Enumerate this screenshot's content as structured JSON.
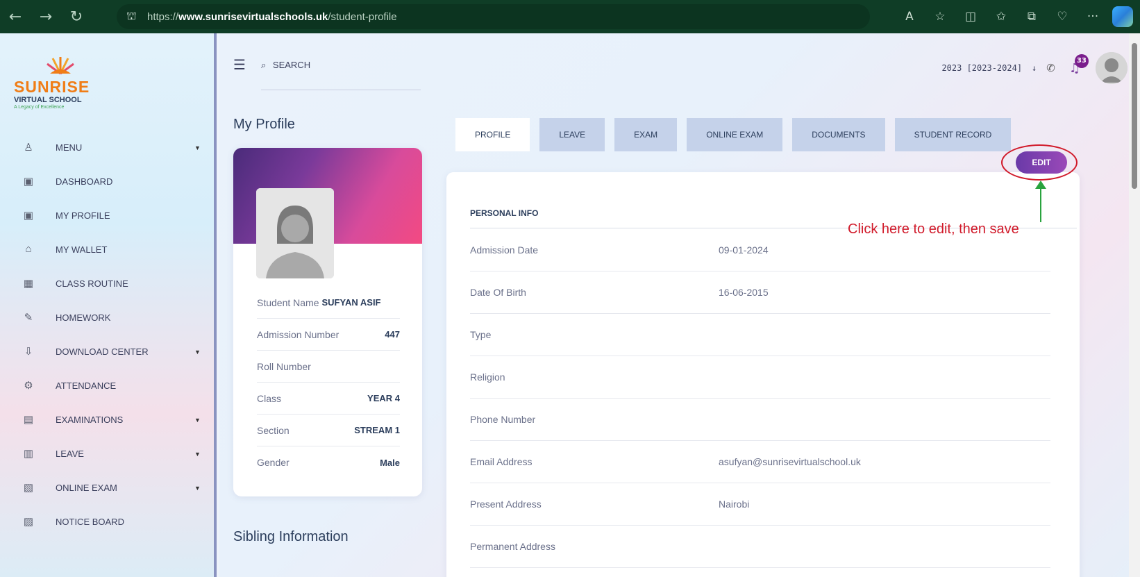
{
  "browser": {
    "url_prefix": "https://",
    "url_host": "www.sunrisevirtualschools.uk",
    "url_path": "/student-profile"
  },
  "logo": {
    "title": "SUNRISE",
    "subtitle": "VIRTUAL SCHOOL",
    "tagline": "A Legacy of Excellence"
  },
  "sidebar": {
    "items": [
      {
        "label": "MENU",
        "icon": "user-menu-icon",
        "has_caret": true
      },
      {
        "label": "DASHBOARD",
        "icon": "dashboard-icon",
        "has_caret": false
      },
      {
        "label": "MY PROFILE",
        "icon": "profile-icon",
        "has_caret": false
      },
      {
        "label": "MY WALLET",
        "icon": "wallet-icon",
        "has_caret": false
      },
      {
        "label": "CLASS ROUTINE",
        "icon": "calendar-icon",
        "has_caret": false
      },
      {
        "label": "HOMEWORK",
        "icon": "homework-icon",
        "has_caret": false
      },
      {
        "label": "DOWNLOAD CENTER",
        "icon": "download-icon",
        "has_caret": true
      },
      {
        "label": "ATTENDANCE",
        "icon": "attendance-icon",
        "has_caret": false
      },
      {
        "label": "EXAMINATIONS",
        "icon": "exam-icon",
        "has_caret": true
      },
      {
        "label": "LEAVE",
        "icon": "leave-icon",
        "has_caret": true
      },
      {
        "label": "ONLINE EXAM",
        "icon": "online-exam-icon",
        "has_caret": true
      },
      {
        "label": "NOTICE BOARD",
        "icon": "notice-icon",
        "has_caret": false
      }
    ]
  },
  "header": {
    "search_label": "SEARCH",
    "session": "2023 [2023-2024]",
    "notification_count": "33"
  },
  "page_title": "My Profile",
  "profile_card": {
    "student_name_label": "Student Name",
    "student_name": "SUFYAN ASIF",
    "admission_label": "Admission Number",
    "admission_number": "447",
    "roll_label": "Roll Number",
    "roll_number": "",
    "class_label": "Class",
    "class_value": "YEAR 4",
    "section_label": "Section",
    "section_value": "STREAM 1",
    "gender_label": "Gender",
    "gender_value": "Male"
  },
  "sibling_title": "Sibling Information",
  "tabs": [
    "PROFILE",
    "LEAVE",
    "EXAM",
    "ONLINE EXAM",
    "DOCUMENTS",
    "STUDENT RECORD"
  ],
  "edit_label": "EDIT",
  "annotation": "Click here to edit, then save",
  "personal_info": {
    "heading": "PERSONAL INFO",
    "rows": [
      {
        "label": "Admission Date",
        "value": "09-01-2024"
      },
      {
        "label": "Date Of Birth",
        "value": "16-06-2015"
      },
      {
        "label": "Type",
        "value": ""
      },
      {
        "label": "Religion",
        "value": ""
      },
      {
        "label": "Phone Number",
        "value": ""
      },
      {
        "label": "Email Address",
        "value": "asufyan@sunrisevirtualschool.uk"
      },
      {
        "label": "Present Address",
        "value": "Nairobi"
      },
      {
        "label": "Permanent Address",
        "value": ""
      }
    ]
  },
  "colors": {
    "browser_bar": "#0f3d26",
    "accent_purple": "#7a3e9d",
    "annotation_red": "#d11a2a",
    "annotation_green": "#29a33e"
  }
}
